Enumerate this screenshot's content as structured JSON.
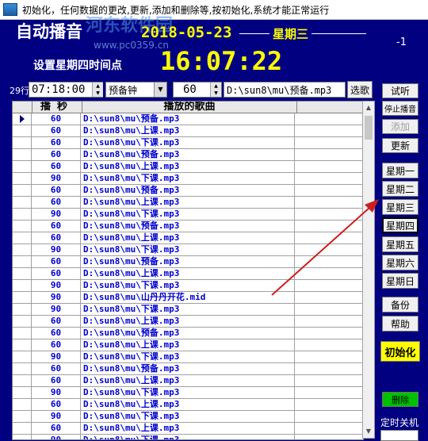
{
  "window": {
    "title": "初始化，任何数据的更改,更新,添加和删除等,按初始化,系统才能正常运行"
  },
  "header": {
    "brand": "自动播音",
    "date": "2018-05-23",
    "weekday": "星期三",
    "minus": "-1",
    "setting_label": "设置星期四时间点",
    "clock": "16:07:22"
  },
  "watermark": {
    "line1": "河东软件园",
    "line2": "www.pc0359.cn"
  },
  "editor": {
    "row_count": "29行",
    "time_value": "07:18:00",
    "type_value": "预备钟",
    "seconds_value": "60",
    "path_value": "D:\\sun8\\mu\\预备.mp3",
    "select_song_label": "选歌"
  },
  "table": {
    "headers": {
      "seconds": "播秒",
      "song": "播放的歌曲"
    },
    "rows": [
      {
        "sec": "60",
        "song": "D:\\sun8\\mu\\预备.mp3",
        "selected": true
      },
      {
        "sec": "60",
        "song": "D:\\sun8\\mu\\上课.mp3"
      },
      {
        "sec": "60",
        "song": "D:\\sun8\\mu\\下课.mp3"
      },
      {
        "sec": "60",
        "song": "D:\\sun8\\mu\\预备.mp3"
      },
      {
        "sec": "60",
        "song": "D:\\sun8\\mu\\上课.mp3"
      },
      {
        "sec": "90",
        "song": "D:\\sun8\\mu\\下课.mp3"
      },
      {
        "sec": "60",
        "song": "D:\\sun8\\mu\\预备.mp3"
      },
      {
        "sec": "60",
        "song": "D:\\sun8\\mu\\上课.mp3"
      },
      {
        "sec": "90",
        "song": "D:\\sun8\\mu\\下课.mp3"
      },
      {
        "sec": "60",
        "song": "D:\\sun8\\mu\\预备.mp3"
      },
      {
        "sec": "60",
        "song": "D:\\sun8\\mu\\上课.mp3"
      },
      {
        "sec": "90",
        "song": "D:\\sun8\\mu\\下课.mp3"
      },
      {
        "sec": "60",
        "song": "D:\\sun8\\mu\\预备.mp3"
      },
      {
        "sec": "60",
        "song": "D:\\sun8\\mu\\上课.mp3"
      },
      {
        "sec": "90",
        "song": "D:\\sun8\\mu\\下课.mp3"
      },
      {
        "sec": "90",
        "song": "D:\\sun8\\mu\\山丹丹开花.mid"
      },
      {
        "sec": "90",
        "song": "D:\\sun8\\mu\\下课.mp3"
      },
      {
        "sec": "60",
        "song": "D:\\sun8\\mu\\上课.mp3"
      },
      {
        "sec": "60",
        "song": "D:\\sun8\\mu\\预备.mp3"
      },
      {
        "sec": "60",
        "song": "D:\\sun8\\mu\\上课.mp3"
      },
      {
        "sec": "90",
        "song": "D:\\sun8\\mu\\下课.mp3"
      },
      {
        "sec": "60",
        "song": "D:\\sun8\\mu\\预备.mp3"
      },
      {
        "sec": "60",
        "song": "D:\\sun8\\mu\\上课.mp3"
      },
      {
        "sec": "90",
        "song": "D:\\sun8\\mu\\下课.mp3"
      },
      {
        "sec": "60",
        "song": "D:\\sun8\\mu\\上课.mp3"
      },
      {
        "sec": "90",
        "song": "D:\\sun8\\mu\\下课.mp3"
      },
      {
        "sec": "60",
        "song": "D:\\sun8\\mu\\上课.mp3"
      },
      {
        "sec": "90",
        "song": "D:\\sun8\\mu\\下课.mp3"
      }
    ]
  },
  "buttons": {
    "preview": "试听",
    "stop": "停止播音",
    "add": "添加",
    "update": "更新",
    "mon": "星期一",
    "tue": "星期二",
    "wed": "星期三",
    "thu": "星期四",
    "fri": "星期五",
    "sat": "星期六",
    "sun": "星期日",
    "backup": "备份",
    "help": "帮助",
    "init": "初始化",
    "delete": "删除"
  },
  "shutdown": {
    "label": "定时关机"
  },
  "colors": {
    "background": "#000080",
    "accent_yellow": "#ffff00",
    "table_text": "#0000cc",
    "annotation_arrow": "#cc2020",
    "delete_button": "#00c000"
  }
}
